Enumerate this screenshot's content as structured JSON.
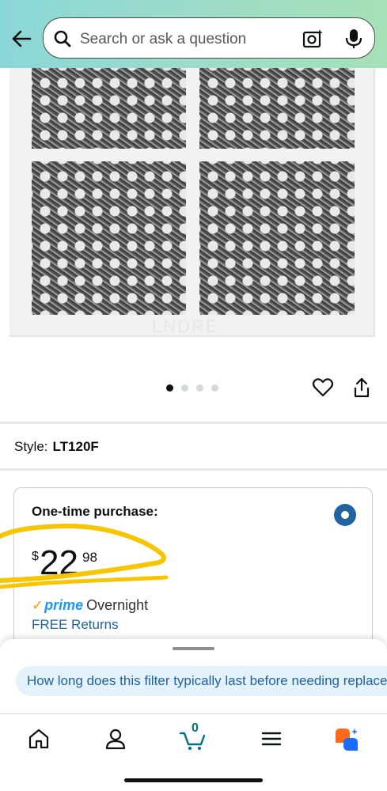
{
  "header": {
    "search": {
      "placeholder": "Search or ask a question"
    },
    "icons": [
      "back-arrow-icon",
      "search-icon",
      "camera-icon",
      "microphone-icon"
    ]
  },
  "product": {
    "image_watermark": "LNDRE",
    "gallery": {
      "count": 4,
      "active_index": 0
    }
  },
  "style": {
    "label": "Style:",
    "value": "LT120F"
  },
  "buybox": {
    "title": "One-time purchase:",
    "price": {
      "symbol": "$",
      "whole": "22",
      "fraction": "98"
    },
    "prime": {
      "word": "prime",
      "delivery": "Overnight"
    },
    "returns": "FREE Returns",
    "selected": true
  },
  "rufus": {
    "suggestion": "How long does this filter typically last before needing replacement?"
  },
  "nav": {
    "cart_count": "0",
    "items": [
      "home-icon",
      "account-icon",
      "cart-icon",
      "menu-icon",
      "rufus-icon"
    ]
  },
  "colors": {
    "accent": "#2162a1",
    "prime": "#1a98ff",
    "highlight": "#f7c600"
  }
}
